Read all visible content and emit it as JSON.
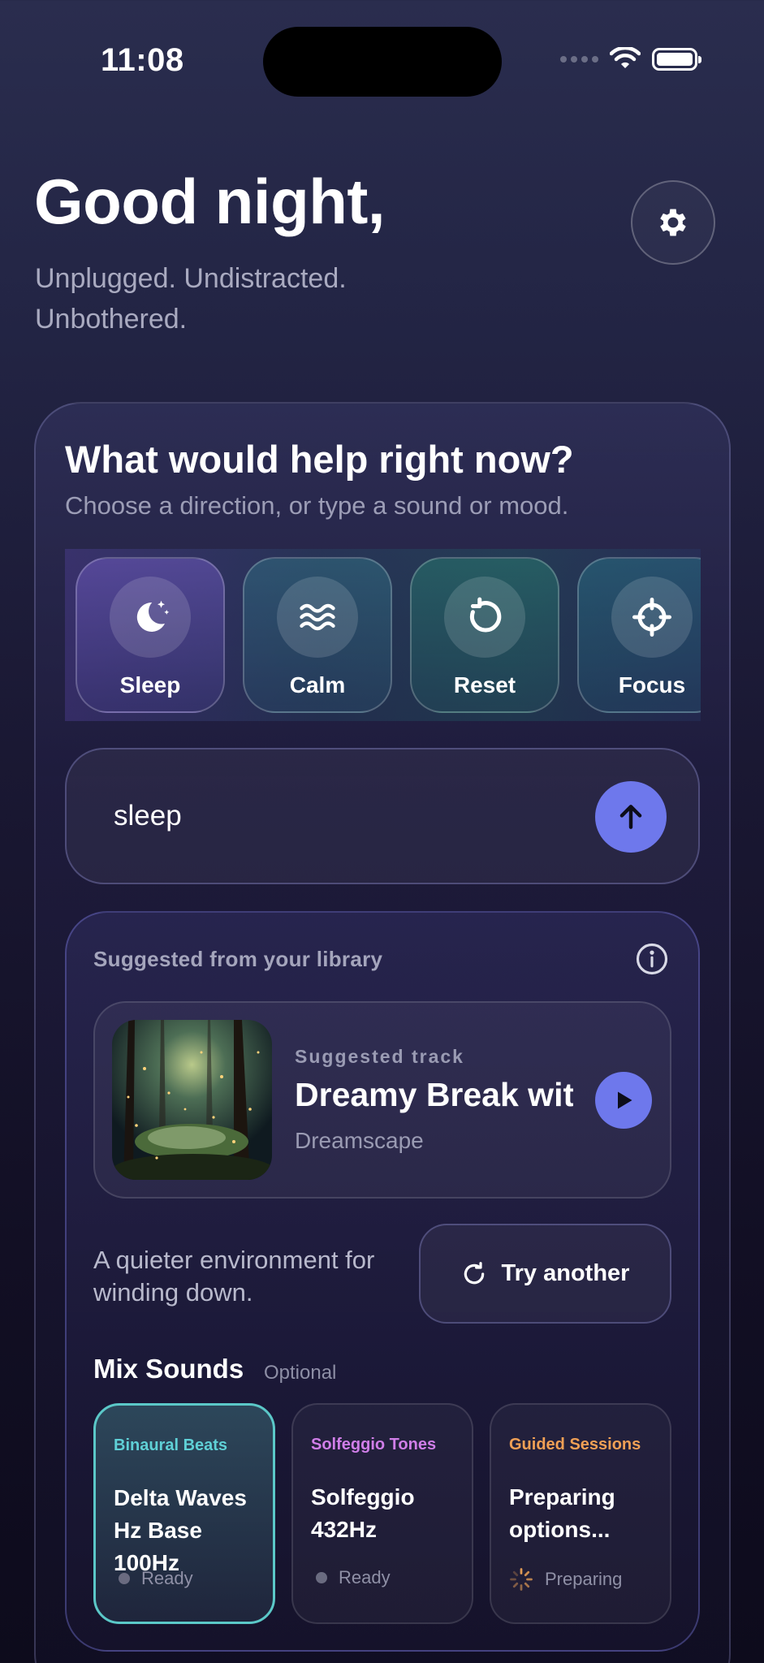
{
  "status_bar": {
    "time": "11:08"
  },
  "header": {
    "greeting": "Good night,",
    "subtitle": "Unplugged. Undistracted. Unbothered."
  },
  "prompt": {
    "title": "What would help right now?",
    "subtitle": "Choose a direction, or type a sound or mood."
  },
  "directions": [
    {
      "label": "Sleep",
      "icon": "moon-stars-icon"
    },
    {
      "label": "Calm",
      "icon": "waves-icon"
    },
    {
      "label": "Reset",
      "icon": "reset-icon"
    },
    {
      "label": "Focus",
      "icon": "crosshair-icon"
    }
  ],
  "search": {
    "value": "sleep"
  },
  "suggestion": {
    "section_label": "Suggested from your library",
    "kicker": "Suggested track",
    "title": "Dreamy Break with",
    "artist": "Dreamscape",
    "description": "A quieter environment for winding down.",
    "try_another": "Try another"
  },
  "mix": {
    "title": "Mix Sounds",
    "optional": "Optional",
    "items": [
      {
        "kicker": "Binaural Beats",
        "name": "Delta Waves Hz Base 100Hz",
        "status": "Ready",
        "color": "#5fd0d6"
      },
      {
        "kicker": "Solfeggio Tones",
        "name": "Solfeggio 432Hz",
        "status": "Ready",
        "color": "#d07ee8"
      },
      {
        "kicker": "Guided Sessions",
        "name": "Preparing options...",
        "status": "Preparing",
        "color": "#f0a055"
      }
    ]
  },
  "colors": {
    "accent": "#6e78ec",
    "selected_border": "#5bc8c8"
  }
}
